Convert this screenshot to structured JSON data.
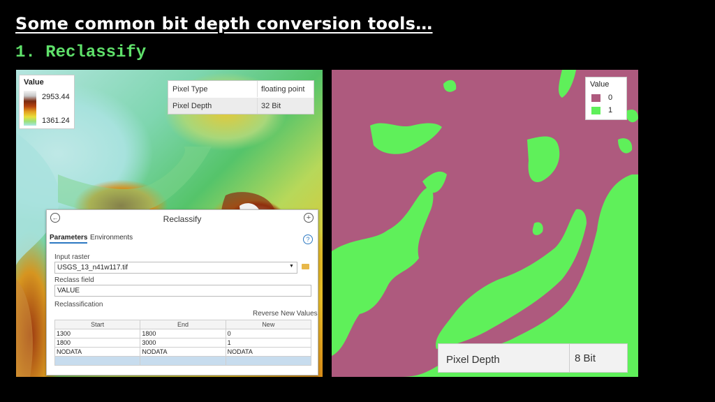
{
  "slide": {
    "title": "Some common bit depth conversion tools…",
    "subtitle": "1. Reclassify"
  },
  "left_map": {
    "legend": {
      "title": "Value",
      "max": "2953.44",
      "min": "1361.24"
    },
    "properties": [
      {
        "key": "Pixel Type",
        "value": "floating point"
      },
      {
        "key": "Pixel Depth",
        "value": "32 Bit"
      }
    ]
  },
  "reclassify": {
    "title": "Reclassify",
    "tabs": [
      "Parameters",
      "Environments"
    ],
    "input_raster_label": "Input raster",
    "input_raster_value": "USGS_13_n41w117.tif",
    "reclass_field_label": "Reclass field",
    "reclass_field_value": "VALUE",
    "reclassification_label": "Reclassification",
    "reverse_label": "Reverse New Values",
    "columns": [
      "Start",
      "End",
      "New"
    ],
    "rows": [
      [
        "1300",
        "1800",
        "0"
      ],
      [
        "1800",
        "3000",
        "1"
      ],
      [
        "NODATA",
        "NODATA",
        "NODATA"
      ]
    ]
  },
  "right_map": {
    "legend": {
      "title": "Value",
      "items": [
        {
          "label": "0",
          "color": "#ae5a7e"
        },
        {
          "label": "1",
          "color": "#5ff05a"
        }
      ]
    },
    "properties": {
      "key": "Pixel Depth",
      "value": "8 Bit"
    }
  },
  "colors": {
    "accent_green": "#5fe06a",
    "class0": "#ae5a7e",
    "class1": "#5ff05a"
  }
}
